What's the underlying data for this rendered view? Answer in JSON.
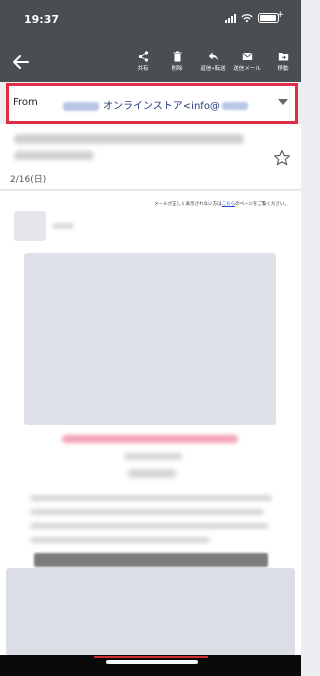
{
  "status_bar": {
    "time": "19:37"
  },
  "toolbar": {
    "share_label": "共有",
    "delete_label": "削除",
    "reply_forward_label": "返信•転送",
    "sent_mail_label": "送信メール",
    "move_label": "移動"
  },
  "from_field": {
    "label": "From",
    "value": "オンラインストア<info@"
  },
  "message": {
    "date": "2/16(日)"
  },
  "mail_body": {
    "notice_prefix": "メールが正しく表示されない方は",
    "notice_link": "こちら",
    "notice_suffix": "のページをご覧ください。"
  },
  "colors": {
    "toolbar_bg": "#4a4d51",
    "highlight_border": "#e22c44",
    "from_text": "#223a7a"
  }
}
